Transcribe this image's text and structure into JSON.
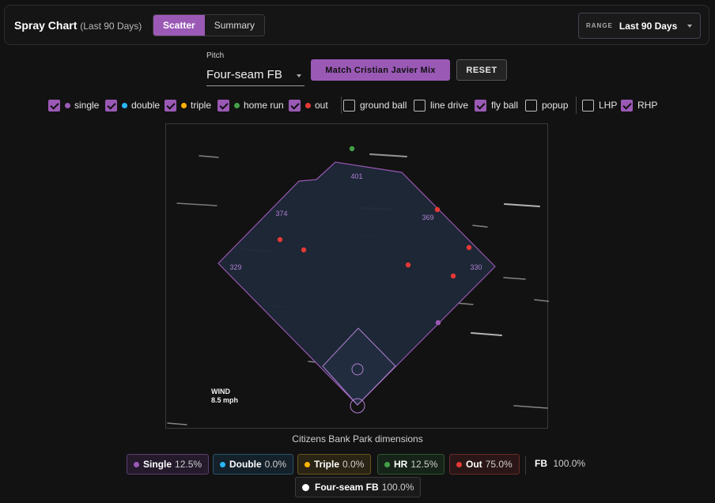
{
  "header": {
    "title": "Spray Chart",
    "subtitle": "(Last 90 Days)",
    "view_tabs": [
      {
        "label": "Scatter",
        "active": true
      },
      {
        "label": "Summary",
        "active": false
      }
    ],
    "range_label": "RANGE",
    "range_value": "Last 90 Days"
  },
  "controls": {
    "pitch_label": "Pitch",
    "pitch_value": "Four-seam FB",
    "match_button": "Match Cristian Javier Mix",
    "reset_button": "RESET"
  },
  "filters": {
    "outcomes": [
      {
        "label": "single",
        "checked": true,
        "color": "#9b59b6"
      },
      {
        "label": "double",
        "checked": true,
        "color": "#29b6f6"
      },
      {
        "label": "triple",
        "checked": true,
        "color": "#ffb300"
      },
      {
        "label": "home run",
        "checked": true,
        "color": "#43a047"
      },
      {
        "label": "out",
        "checked": true,
        "color": "#e53935"
      }
    ],
    "batted": [
      {
        "label": "ground ball",
        "checked": false
      },
      {
        "label": "line drive",
        "checked": false
      },
      {
        "label": "fly ball",
        "checked": true
      },
      {
        "label": "popup",
        "checked": false
      }
    ],
    "hand": [
      {
        "label": "LHP",
        "checked": false
      },
      {
        "label": "RHP",
        "checked": true
      }
    ]
  },
  "field": {
    "distances": [
      "329",
      "374",
      "401",
      "369",
      "330"
    ],
    "wind_label": "WIND",
    "wind_speed": "8.5 mph",
    "caption": "Citizens Bank Park dimensions",
    "colors": {
      "field_fill": "#1e2838",
      "field_stroke": "#9b59b6",
      "label": "#b07fd0"
    },
    "hits": [
      {
        "type": "home run",
        "color": "#43a047"
      },
      {
        "type": "out",
        "color": "#e53935"
      },
      {
        "type": "out",
        "color": "#e53935"
      },
      {
        "type": "out",
        "color": "#e53935"
      },
      {
        "type": "out",
        "color": "#e53935"
      },
      {
        "type": "out",
        "color": "#e53935"
      },
      {
        "type": "out",
        "color": "#e53935"
      },
      {
        "type": "single",
        "color": "#9b59b6"
      }
    ]
  },
  "legend": {
    "chips": [
      {
        "label": "Single",
        "pct": "12.5%",
        "color": "#9b59b6",
        "bg": "#241a2c",
        "border": "#5a3d6e"
      },
      {
        "label": "Double",
        "pct": "0.0%",
        "color": "#29b6f6",
        "bg": "#14212a",
        "border": "#2a5468"
      },
      {
        "label": "Triple",
        "pct": "0.0%",
        "color": "#ffb300",
        "bg": "#2a2414",
        "border": "#6a5420"
      },
      {
        "label": "HR",
        "pct": "12.5%",
        "color": "#43a047",
        "bg": "#162318",
        "border": "#2e5631"
      },
      {
        "label": "Out",
        "pct": "75.0%",
        "color": "#e53935",
        "bg": "#2a1616",
        "border": "#6a2a2a"
      }
    ],
    "fb_label": "FB",
    "fb_pct": "100.0%",
    "pitch_chip": {
      "label": "Four-seam FB",
      "pct": "100.0%",
      "color": "#ffffff"
    }
  }
}
